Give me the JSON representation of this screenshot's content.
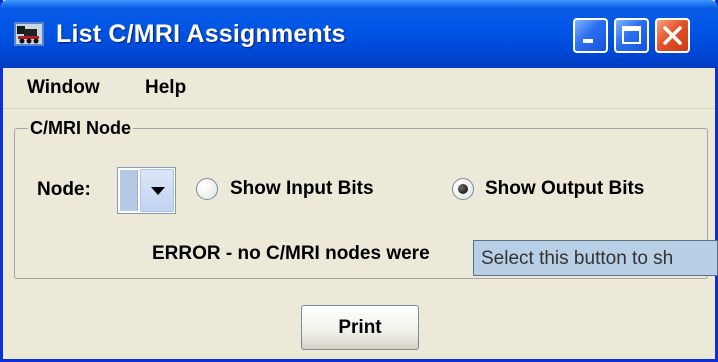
{
  "window": {
    "title": "List C/MRI Assignments",
    "controls": [
      "minimize-icon",
      "maximize-icon",
      "close-icon"
    ],
    "colors": {
      "titlebar": "#0055e5",
      "close": "#e5542a",
      "frame": "#0831d9",
      "background": "#ece9d8"
    }
  },
  "menubar": {
    "items": [
      {
        "label": "Window"
      },
      {
        "label": "Help"
      }
    ]
  },
  "node_panel": {
    "title": "C/MRI Node",
    "node_label": "Node:",
    "node_select_value": "",
    "radio_input_label": "Show Input Bits",
    "radio_input_selected": false,
    "radio_output_label": "Show Output Bits",
    "radio_output_selected": true
  },
  "status": {
    "error_text": "ERROR - no C/MRI nodes were"
  },
  "tooltip": {
    "text": "Select this button to sh"
  },
  "actions": {
    "print_label": "Print"
  }
}
